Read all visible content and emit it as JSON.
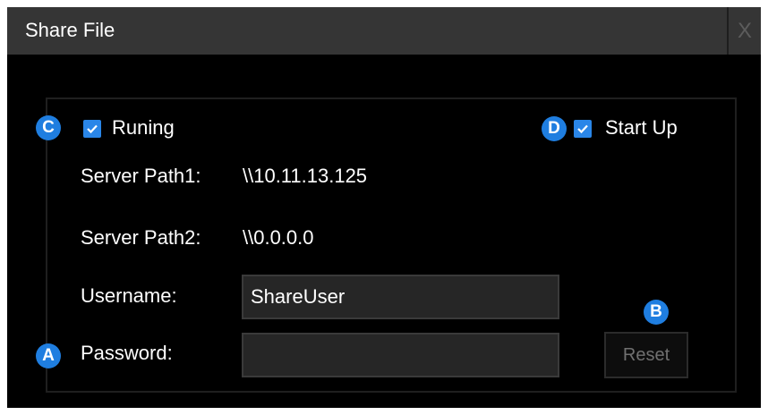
{
  "dialog": {
    "title": "Share File",
    "close_label": "X"
  },
  "running": {
    "label": "Runing",
    "checked": true,
    "badge": "C"
  },
  "startup": {
    "label": "Start Up",
    "checked": true,
    "badge": "D"
  },
  "server_path1": {
    "label": "Server Path1:",
    "value": "\\\\10.11.13.125"
  },
  "server_path2": {
    "label": "Server Path2:",
    "value": "\\\\0.0.0.0"
  },
  "username": {
    "label": "Username:",
    "value": "ShareUser"
  },
  "password": {
    "label": "Password:",
    "value": "",
    "badge": "A"
  },
  "reset": {
    "label": "Reset",
    "badge": "B"
  },
  "colors": {
    "accent": "#2a86e8",
    "badge": "#1f7ee0",
    "background": "#000000",
    "titlebar": "#353535"
  },
  "icons": [
    "checkbox-checked-icon",
    "close-icon"
  ]
}
